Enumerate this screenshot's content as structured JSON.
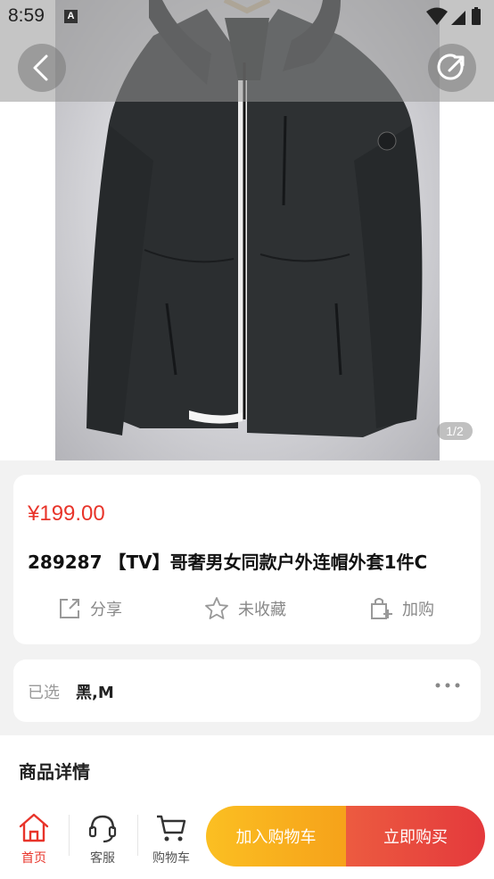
{
  "status_bar": {
    "time": "8:59",
    "notification_icon": "A"
  },
  "gallery": {
    "pager": "1/2",
    "image_alt": "jacket-photo"
  },
  "product": {
    "price": "¥199.00",
    "title": "289287 【TV】哥奢男女同款户外连帽外套1件C",
    "actions": {
      "share": "分享",
      "favorite": "未收藏",
      "add_cart": "加购"
    }
  },
  "selection": {
    "label": "已选",
    "value": "黑,M"
  },
  "detail": {
    "title": "商品详情"
  },
  "bottom_nav": {
    "home": "首页",
    "service": "客服",
    "cart": "购物车",
    "add_to_cart": "加入购物车",
    "buy_now": "立即购买"
  },
  "colors": {
    "price_red": "#e8342a",
    "add_button_orange": "#f6a21a",
    "buy_button_red": "#e4393c",
    "jacket": "#2c2f31"
  }
}
